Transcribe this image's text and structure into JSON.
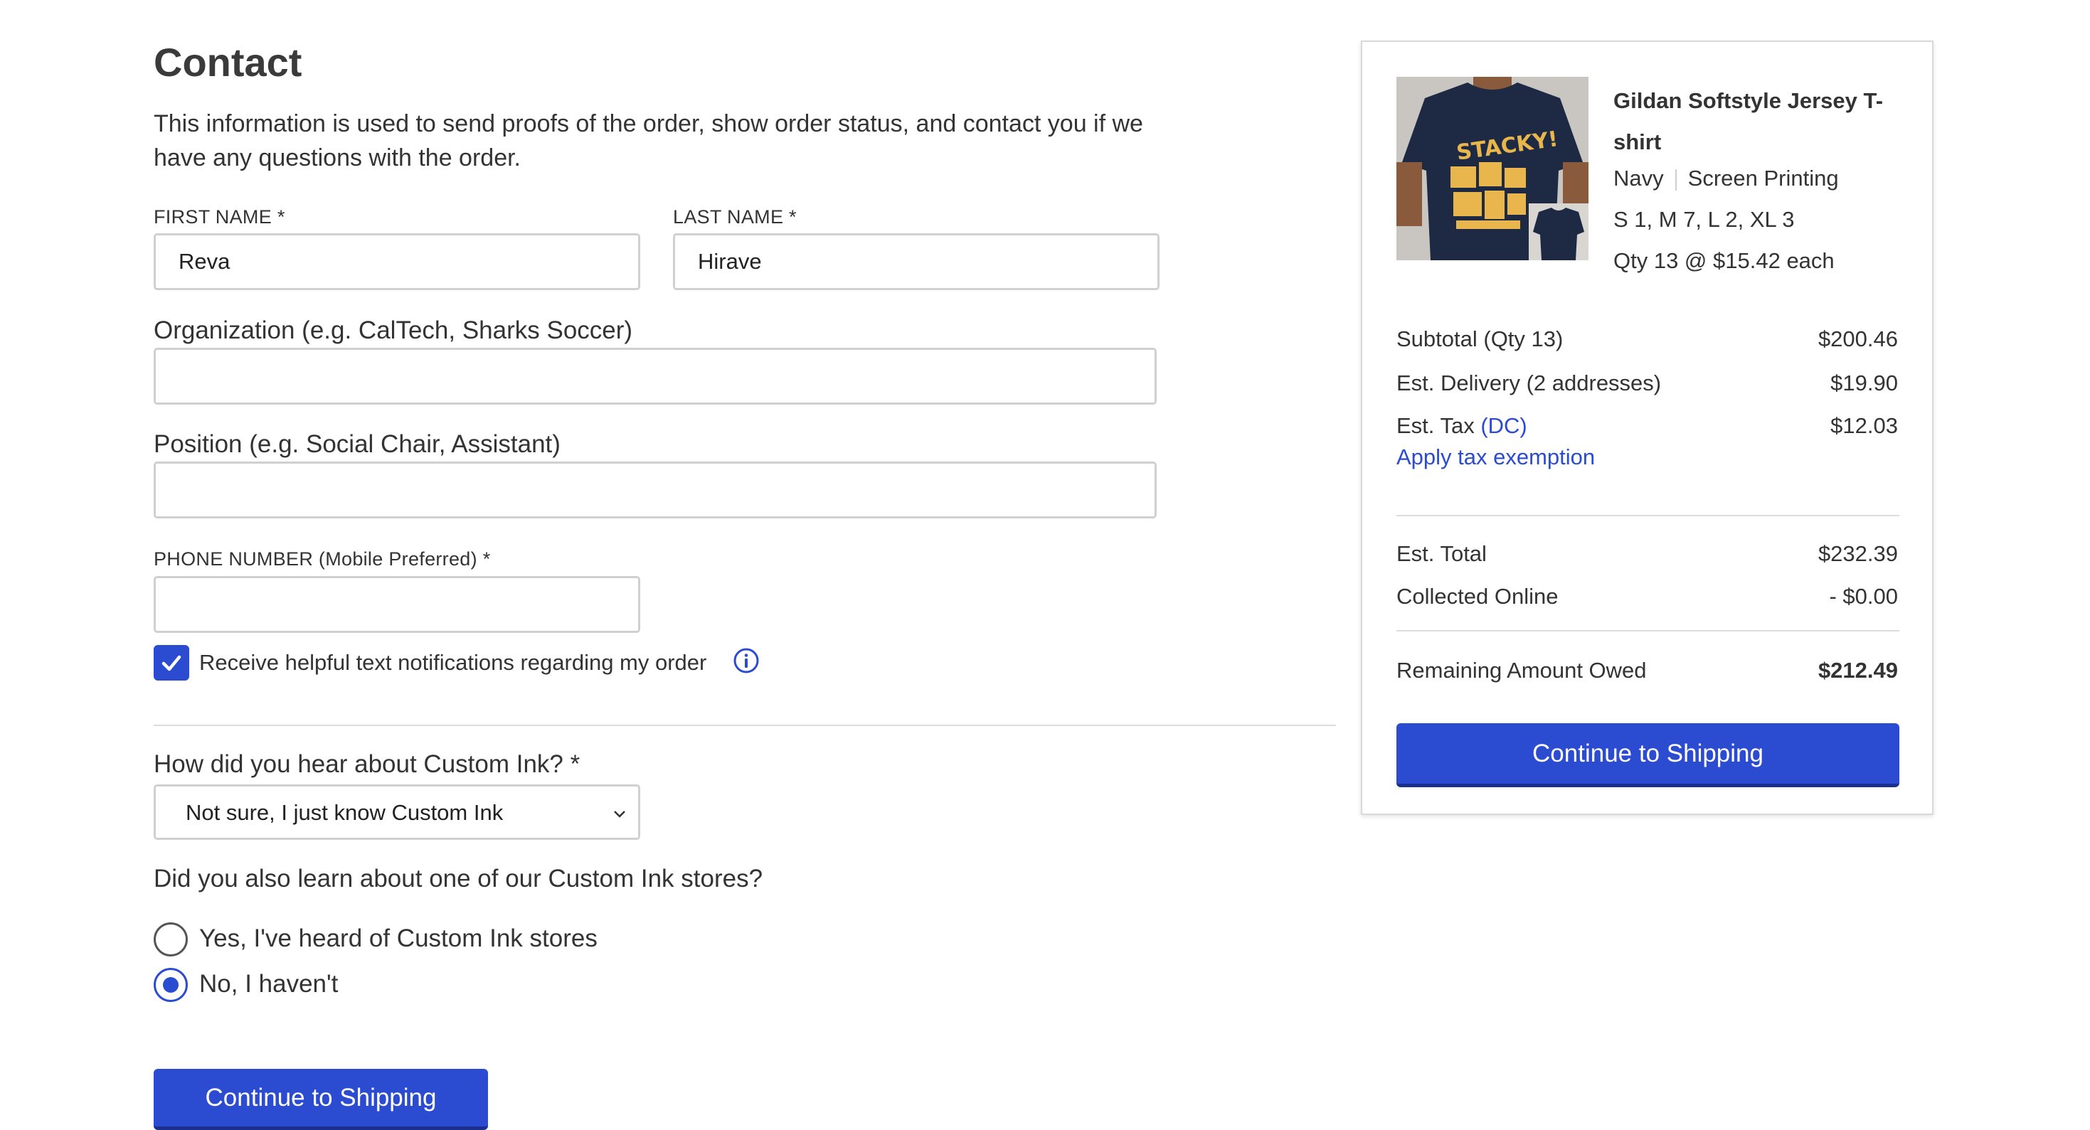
{
  "contact": {
    "title": "Contact",
    "intro": "This information is used to send proofs of the order, show order status, and contact you if we have any questions with the order.",
    "first_name_label": "FIRST NAME *",
    "first_name_value": "Reva",
    "last_name_label": "LAST NAME *",
    "last_name_value": "Hirave",
    "organization_label": "Organization (e.g. CalTech, Sharks Soccer)",
    "organization_value": "",
    "position_label": "Position (e.g. Social Chair, Assistant)",
    "position_value": "",
    "phone_label": "PHONE NUMBER (Mobile Preferred) *",
    "phone_value": "",
    "sms_checkbox_label": "Receive helpful text notifications regarding my order",
    "sms_checked": true
  },
  "referral": {
    "question": "How did you hear about Custom Ink? *",
    "selected": "Not sure, I just know Custom Ink"
  },
  "stores": {
    "question": "Did you also learn about one of our Custom Ink stores?",
    "options": [
      {
        "label": "Yes, I've heard of Custom Ink stores",
        "checked": false
      },
      {
        "label": "No, I haven't",
        "checked": true
      }
    ]
  },
  "continue_label": "Continue to Shipping",
  "summary": {
    "product": {
      "name": "Gildan Softstyle Jersey T-shirt",
      "color": "Navy",
      "method": "Screen Printing",
      "sizes": "S 1, M 7, L 2, XL 3",
      "qty": "Qty 13 @ $15.42 each",
      "print_text": "STACKY!"
    },
    "subtotal_label": "Subtotal (Qty 13)",
    "subtotal_value": "$200.46",
    "delivery_label": "Est. Delivery (2 addresses)",
    "delivery_value": "$19.90",
    "tax_label": "Est. Tax",
    "tax_region": "(DC)",
    "tax_value": "$12.03",
    "tax_exemption_link": "Apply tax exemption",
    "total_label": "Est. Total",
    "total_value": "$232.39",
    "collected_label": "Collected Online",
    "collected_value": "- $0.00",
    "remaining_label": "Remaining Amount Owed",
    "remaining_value": "$212.49",
    "continue_label": "Continue to Shipping"
  },
  "colors": {
    "accent": "#2b4bd1",
    "shirt_navy": "#1e2a44",
    "print_yellow": "#e8b64c"
  }
}
